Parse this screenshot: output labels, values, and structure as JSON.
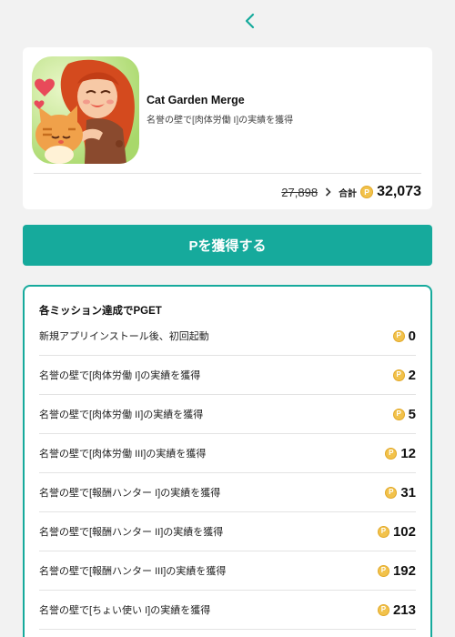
{
  "app": {
    "name": "Cat Garden Merge",
    "description": "名誉の壁で[肉体労働 I]の実績を獲得",
    "old_points": "27,898",
    "total_label": "合計",
    "total_points": "32,073"
  },
  "cta": {
    "label": "Pを獲得する"
  },
  "coin_symbol": "P",
  "missions": {
    "title": "各ミッション達成でPGET",
    "items": [
      {
        "label": "新規アプリインストール後、初回起動",
        "points": "0"
      },
      {
        "label": "名誉の壁で[肉体労働 I]の実績を獲得",
        "points": "2"
      },
      {
        "label": "名誉の壁で[肉体労働 II]の実績を獲得",
        "points": "5"
      },
      {
        "label": "名誉の壁で[肉体労働 III]の実績を獲得",
        "points": "12"
      },
      {
        "label": "名誉の壁で[報酬ハンター I]の実績を獲得",
        "points": "31"
      },
      {
        "label": "名誉の壁で[報酬ハンター II]の実績を獲得",
        "points": "102"
      },
      {
        "label": "名誉の壁で[報酬ハンター III]の実績を獲得",
        "points": "192"
      },
      {
        "label": "名誉の壁で[ちょい使い I]の実績を獲得",
        "points": "213"
      }
    ]
  },
  "colors": {
    "accent": "#16aa9c",
    "coin": "#f2c24b",
    "background": "#f2f2f2"
  },
  "icons": {
    "back": "chevron-left-icon",
    "arrow": "chevron-right-icon",
    "coin": "coin-icon"
  }
}
